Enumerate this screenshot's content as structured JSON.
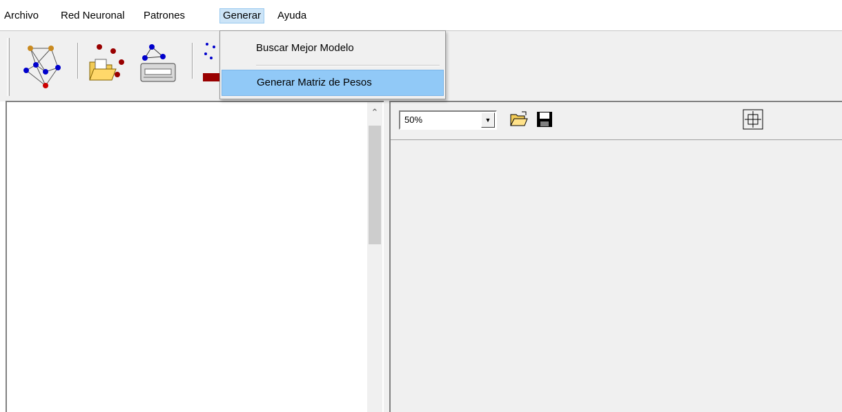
{
  "menubar": {
    "items": [
      {
        "label": "Archivo"
      },
      {
        "label": "Red Neuronal"
      },
      {
        "label": "Patrones"
      },
      {
        "label": "Generar"
      },
      {
        "label": "Ayuda"
      }
    ]
  },
  "dropdown": {
    "items": [
      {
        "label": "Buscar Mejor Modelo"
      },
      {
        "label": "Generar Matriz de Pesos",
        "highlighted": true
      }
    ]
  },
  "toolbar": {
    "icons": [
      "neural-network-icon",
      "open-patterns-icon",
      "network-printer-icon",
      "generate-matrix-icon"
    ]
  },
  "viewer": {
    "zoom_value": "50%",
    "icons": [
      "open-folder-icon",
      "save-disk-icon",
      "fit-selection-icon"
    ]
  },
  "colors": {
    "menu_highlight": "#91c9f7",
    "panel_bg": "#f0f0f0"
  }
}
